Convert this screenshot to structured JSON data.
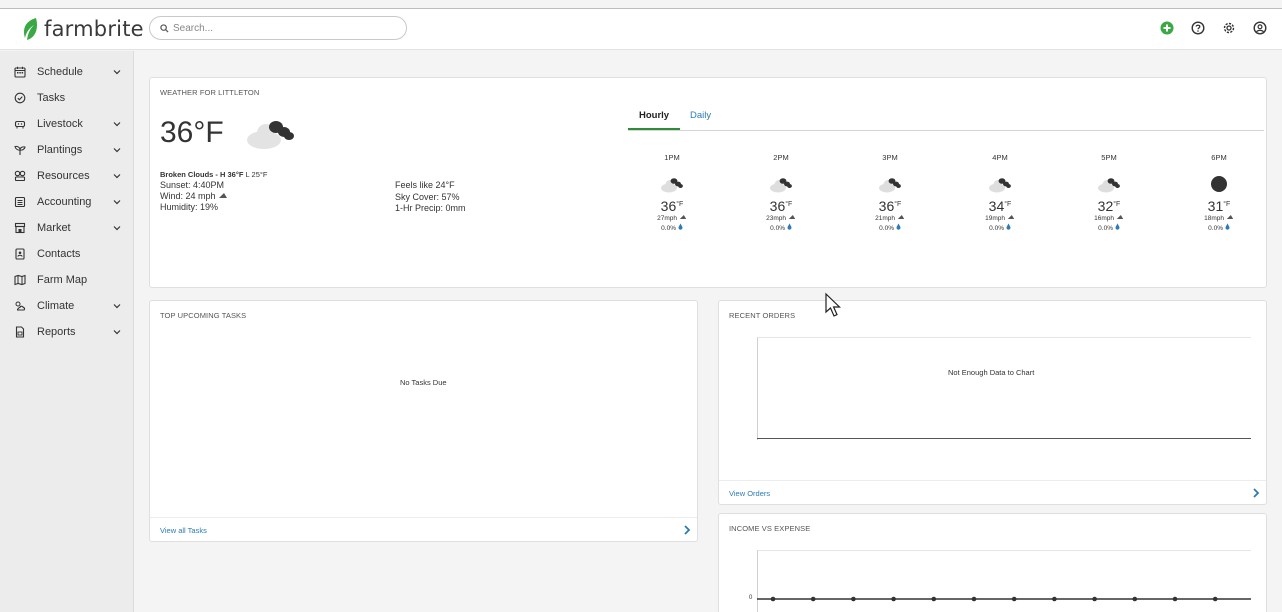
{
  "app": {
    "brand_prefix": "farm",
    "brand_suffix": "brite",
    "colors": {
      "brand_green": "#3aa845",
      "link_blue": "#2b7bb9",
      "text": "#333333"
    }
  },
  "search": {
    "placeholder": "Search..."
  },
  "topbar_icons": [
    "add-icon",
    "help-icon",
    "gear-icon",
    "user-icon"
  ],
  "sidebar": {
    "items": [
      {
        "label": "Schedule",
        "icon": "calendar-icon",
        "expandable": true
      },
      {
        "label": "Tasks",
        "icon": "check-circle-icon",
        "expandable": false
      },
      {
        "label": "Livestock",
        "icon": "cow-icon",
        "expandable": true
      },
      {
        "label": "Plantings",
        "icon": "sprout-icon",
        "expandable": true
      },
      {
        "label": "Resources",
        "icon": "tools-icon",
        "expandable": true
      },
      {
        "label": "Accounting",
        "icon": "ledger-icon",
        "expandable": true
      },
      {
        "label": "Market",
        "icon": "store-icon",
        "expandable": true
      },
      {
        "label": "Contacts",
        "icon": "contact-card-icon",
        "expandable": false
      },
      {
        "label": "Farm Map",
        "icon": "map-icon",
        "expandable": false
      },
      {
        "label": "Climate",
        "icon": "cloud-sun-icon",
        "expandable": true
      },
      {
        "label": "Reports",
        "icon": "report-icon",
        "expandable": true
      }
    ]
  },
  "weather": {
    "title": "WEATHER FOR LITTLETON",
    "current_temp": "36°F",
    "condition": "Broken Clouds",
    "high": "H 36°F",
    "low": "L 25°F",
    "sunset": "Sunset: 4:40PM",
    "wind": "Wind: 24 mph",
    "humidity": "Humidity: 19%",
    "feels_like": "Feels like 24°F",
    "sky_cover": "Sky Cover: 57%",
    "precip": "1-Hr Precip: 0mm",
    "tabs": {
      "hourly": "Hourly",
      "daily": "Daily",
      "active": "hourly"
    },
    "hourly": [
      {
        "time": "1PM",
        "temp": "36",
        "unit": "°F",
        "wind": "27mph",
        "precip": "0.0%",
        "icon": "broken-clouds-icon"
      },
      {
        "time": "2PM",
        "temp": "36",
        "unit": "°F",
        "wind": "23mph",
        "precip": "0.0%",
        "icon": "broken-clouds-icon"
      },
      {
        "time": "3PM",
        "temp": "36",
        "unit": "°F",
        "wind": "21mph",
        "precip": "0.0%",
        "icon": "broken-clouds-icon"
      },
      {
        "time": "4PM",
        "temp": "34",
        "unit": "°F",
        "wind": "19mph",
        "precip": "0.0%",
        "icon": "broken-clouds-icon"
      },
      {
        "time": "5PM",
        "temp": "32",
        "unit": "°F",
        "wind": "16mph",
        "precip": "0.0%",
        "icon": "broken-clouds-icon"
      },
      {
        "time": "6PM",
        "temp": "31",
        "unit": "°F",
        "wind": "18mph",
        "precip": "0.0%",
        "icon": "night-clear-icon"
      }
    ]
  },
  "tasks": {
    "title": "TOP UPCOMING TASKS",
    "empty": "No Tasks Due",
    "footer_link": "View all Tasks"
  },
  "orders": {
    "title": "RECENT ORDERS",
    "empty": "Not Enough Data to Chart",
    "footer_link": "View Orders"
  },
  "income": {
    "title": "INCOME VS EXPENSE",
    "zero_label": "0",
    "point_count_visible": 12
  }
}
